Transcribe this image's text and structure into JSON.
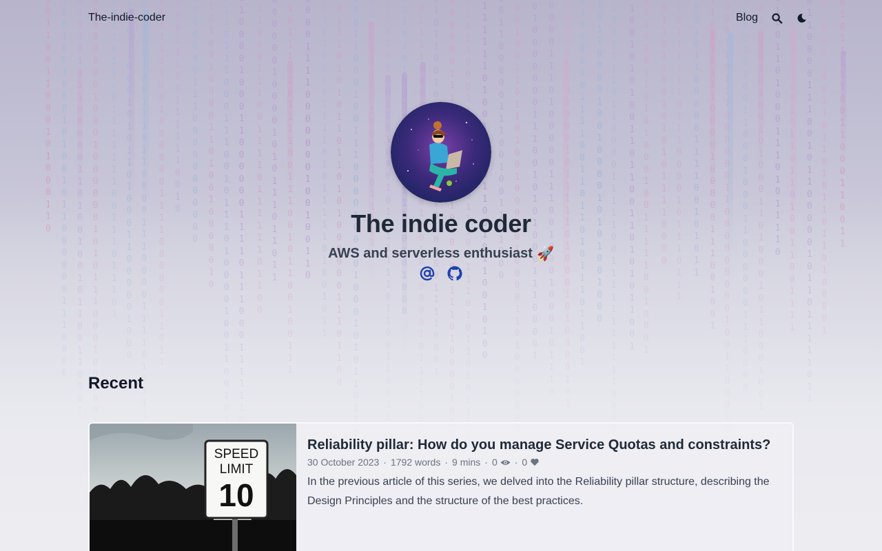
{
  "header": {
    "brand": "The-indie-coder",
    "nav_blog": "Blog",
    "search_icon": "search-icon",
    "theme_icon": "moon-icon"
  },
  "hero": {
    "title": "The indie coder",
    "tagline": "AWS and serverless enthusiast",
    "tagline_emoji": "🚀",
    "socials": [
      {
        "icon": "at-sign-icon",
        "color": "#1e40af"
      },
      {
        "icon": "github-icon",
        "color": "#1e40af"
      }
    ]
  },
  "recent": {
    "heading": "Recent",
    "articles": [
      {
        "title": "Reliability pillar: How do you manage Service Quotas and constraints?",
        "date": "30 October 2023",
        "words": "1792 words",
        "read_time": "9 mins",
        "views": "0",
        "likes": "0",
        "excerpt": "In the previous article of this series, we delved into the Reliability pillar structure, describing the Design Principles and the structure of the best practices.",
        "thumbnail_sign": [
          "SPEED",
          "LIMIT",
          "10"
        ]
      }
    ]
  },
  "colors": {
    "accent": "#1e40af",
    "text": "#1f2937",
    "muted": "#6b7280"
  }
}
